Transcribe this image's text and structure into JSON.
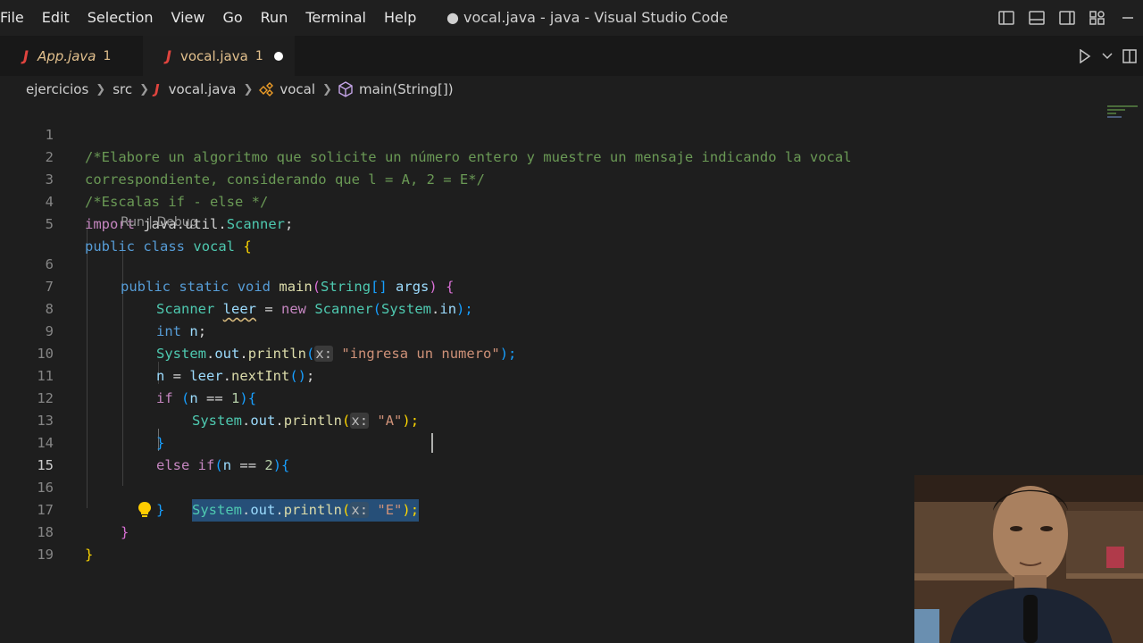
{
  "menu": [
    "File",
    "Edit",
    "Selection",
    "View",
    "Go",
    "Run",
    "Terminal",
    "Help"
  ],
  "window_title": "● vocal.java - java - Visual Studio Code",
  "tabs": [
    {
      "icon": "J",
      "label": "App.java",
      "problems": "1",
      "state": "inactive"
    },
    {
      "icon": "J",
      "label": "vocal.java",
      "problems": "1",
      "state": "active",
      "unsaved": true
    }
  ],
  "breadcrumb": {
    "folder": "ejercicios",
    "subfolder": "src",
    "file": "vocal.java",
    "class": "vocal",
    "method": "main(String[])"
  },
  "codelens": "Run | Debug",
  "current_line": "15",
  "lines": [
    {
      "n": "1",
      "t": [
        "/*Elabore un algoritmo que solicite un número entero y muestre un mensaje indicando la vocal"
      ]
    },
    {
      "n": "2",
      "t": [
        "correspondiente, considerando que l = A, 2 = E*/"
      ]
    },
    {
      "n": "3",
      "t": [
        "/*Escalas if - else */"
      ]
    },
    {
      "n": "4",
      "t": [
        "import",
        " ",
        "java",
        ".",
        "util",
        ".",
        "Scanner",
        ";"
      ]
    },
    {
      "n": "5",
      "t": [
        "public",
        " ",
        "class",
        " ",
        "vocal",
        " ",
        "{"
      ]
    },
    {
      "n": "6",
      "t": [
        "public",
        " ",
        "static",
        " ",
        "void",
        " ",
        "main",
        "(",
        "String",
        "[]",
        " ",
        "args",
        ")",
        " ",
        "{"
      ]
    },
    {
      "n": "7",
      "t": [
        "Scanner",
        " ",
        "leer",
        " = ",
        "new",
        " ",
        "Scanner",
        "(",
        "System",
        ".",
        "in",
        ");"
      ]
    },
    {
      "n": "8",
      "t": [
        "int",
        " ",
        "n",
        ";"
      ]
    },
    {
      "n": "9",
      "t": [
        "System",
        ".",
        "out",
        ".",
        "println",
        "(",
        "x:",
        " ",
        "\"ingresa un numero\"",
        ");"
      ]
    },
    {
      "n": "10",
      "t": [
        "n",
        " = ",
        "leer",
        ".",
        "nextInt",
        "()",
        ";"
      ]
    },
    {
      "n": "11",
      "t": [
        "if",
        " ",
        "(",
        "n",
        " == ",
        "1",
        ")",
        "{"
      ]
    },
    {
      "n": "12",
      "t": [
        "System",
        ".",
        "out",
        ".",
        "println",
        "(",
        "x:",
        " ",
        "\"A\"",
        ");"
      ]
    },
    {
      "n": "13",
      "t": [
        "}"
      ]
    },
    {
      "n": "14",
      "t": [
        "else",
        " ",
        "if",
        "(",
        "n",
        " == ",
        "2",
        ")",
        "{"
      ]
    },
    {
      "n": "15",
      "t": [
        "System",
        ".",
        "out",
        ".",
        "println",
        "(",
        "x:",
        " ",
        "\"E\"",
        ");"
      ]
    },
    {
      "n": "16",
      "t": [
        "}"
      ]
    },
    {
      "n": "17",
      "t": [
        "}"
      ]
    },
    {
      "n": "18",
      "t": [
        "}"
      ]
    },
    {
      "n": "19",
      "t": [
        ""
      ]
    }
  ],
  "colors": {
    "editor_bg": "#1e1e1e",
    "comment": "#6a9955",
    "keyword": "#569cd6",
    "control": "#c586c0",
    "type": "#4ec9b0",
    "variable": "#9cdcfe",
    "function": "#dcdcaa",
    "string": "#ce9178",
    "number": "#b5cea8",
    "selection": "#264f78",
    "tab_label_warning": "#e2c08d",
    "java_icon": "#e0443e"
  },
  "icons": [
    "toggle-primary-sidebar-icon",
    "toggle-panel-icon",
    "toggle-secondary-sidebar-icon",
    "customize-layout-icon",
    "run-icon",
    "chevron-down-icon",
    "split-editor-icon",
    "lightbulb-icon",
    "symbol-class-icon",
    "symbol-method-icon"
  ]
}
